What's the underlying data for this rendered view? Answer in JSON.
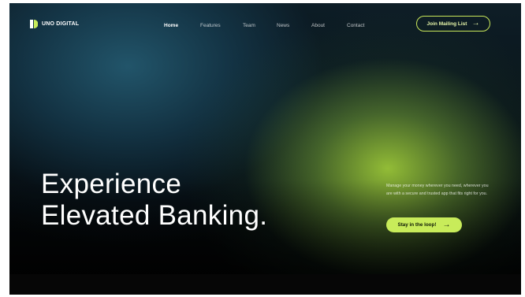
{
  "brand": {
    "name": "UNO DIGITAL",
    "accent": "#c8ec5a"
  },
  "nav": {
    "items": [
      {
        "label": "Home",
        "active": true
      },
      {
        "label": "Features",
        "active": false
      },
      {
        "label": "Team",
        "active": false
      },
      {
        "label": "News",
        "active": false
      },
      {
        "label": "About",
        "active": false
      },
      {
        "label": "Contact",
        "active": false
      }
    ]
  },
  "header": {
    "mailing_label": "Join Mailing List",
    "mailing_icon": "arrow-right-icon"
  },
  "hero": {
    "headline_line1": "Experience",
    "headline_line2": "Elevated Banking.",
    "description": "Manage your money wherever you need, wherever you are with a secure and trusted app that fits right for you.",
    "cta_label": "Stay in the loop!",
    "cta_icon": "arrow-right-icon"
  }
}
